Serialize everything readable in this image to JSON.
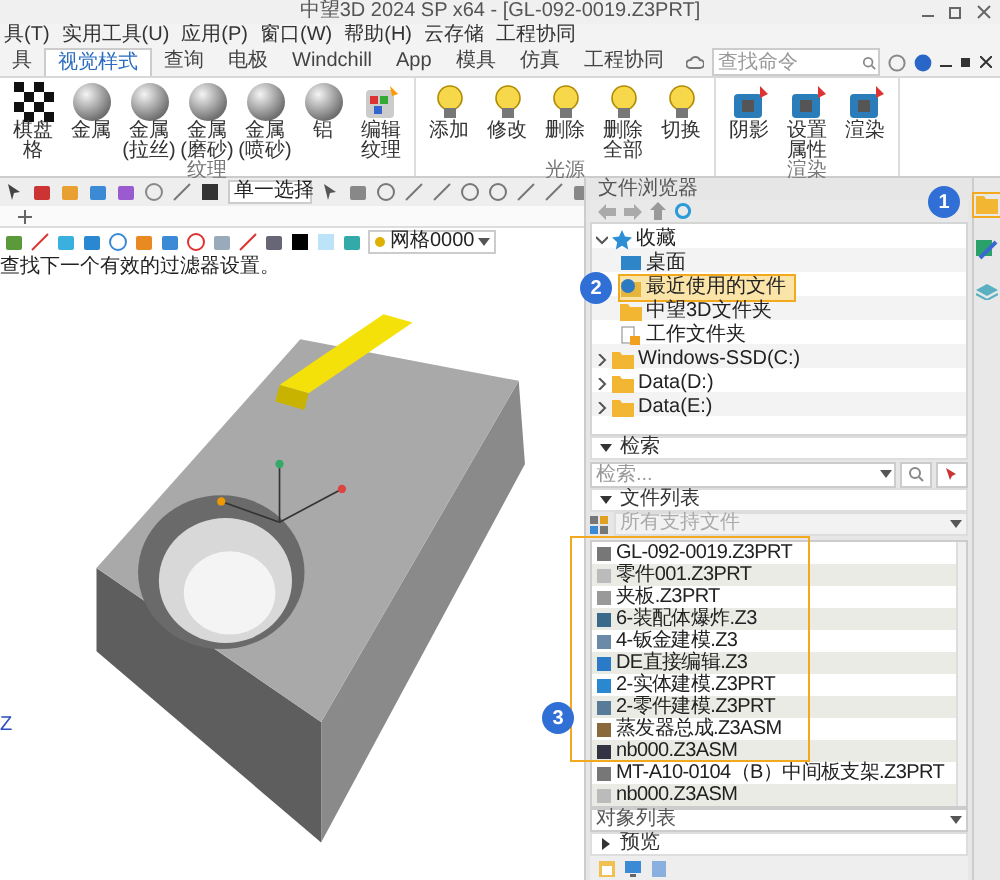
{
  "title_bar": {
    "title": "中望3D 2024 SP x64 - [GL-092-0019.Z3PRT]"
  },
  "menu": [
    "具(T)",
    "实用工具(U)",
    "应用(P)",
    "窗口(W)",
    "帮助(H)",
    "云存储",
    "工程协同"
  ],
  "tabs": [
    {
      "label": "具",
      "selected": false
    },
    {
      "label": "视觉样式",
      "selected": true
    },
    {
      "label": "查询",
      "selected": false
    },
    {
      "label": "电极",
      "selected": false
    },
    {
      "label": "Windchill",
      "selected": false
    },
    {
      "label": "App",
      "selected": false
    },
    {
      "label": "模具",
      "selected": false
    },
    {
      "label": "仿真",
      "selected": false
    },
    {
      "label": "工程协同",
      "selected": false
    }
  ],
  "command_search": {
    "placeholder": "查找命令"
  },
  "ribbon": {
    "groups": [
      {
        "label": "纹理",
        "buttons": [
          {
            "label": "棋盘格",
            "kind": "checker"
          },
          {
            "label": "金属",
            "kind": "sphere"
          },
          {
            "label": "金属 (拉丝)",
            "kind": "sphere"
          },
          {
            "label": "金属 (磨砂)",
            "kind": "sphere"
          },
          {
            "label": "金属 (喷砂)",
            "kind": "sphere"
          },
          {
            "label": "铝",
            "kind": "sphere"
          },
          {
            "label": "编辑纹理",
            "kind": "texture"
          }
        ]
      },
      {
        "label": "光源",
        "buttons": [
          {
            "label": "添加",
            "kind": "bulb"
          },
          {
            "label": "修改",
            "kind": "bulb"
          },
          {
            "label": "删除",
            "kind": "bulb"
          },
          {
            "label": "删除全部",
            "kind": "bulb"
          },
          {
            "label": "切换",
            "kind": "bulb"
          }
        ]
      },
      {
        "label": "渲染",
        "buttons": [
          {
            "label": "阴影",
            "kind": "render"
          },
          {
            "label": "设置属性",
            "kind": "render"
          },
          {
            "label": "渲染",
            "kind": "render"
          }
        ]
      }
    ]
  },
  "toolbar": {
    "selection_filter": "单一选择"
  },
  "view_toolbar": {
    "mesh_setting": "网格0000"
  },
  "hint": "查找下一个有效的过滤器设置。",
  "canvas": {
    "axis_label": "Z"
  },
  "file_browser": {
    "title": "文件浏览器",
    "tree": [
      {
        "label": "收藏",
        "kind": "star",
        "expanded": true,
        "selected": false,
        "children": [
          {
            "label": "桌面",
            "kind": "desktop",
            "selected": false
          },
          {
            "label": "最近使用的文件",
            "kind": "recent",
            "selected": true
          },
          {
            "label": "中望3D文件夹",
            "kind": "folder",
            "selected": false
          },
          {
            "label": "工作文件夹",
            "kind": "work",
            "selected": false
          }
        ]
      },
      {
        "label": "Windows-SSD(C:)",
        "kind": "folder",
        "expanded": false,
        "selected": false
      },
      {
        "label": "Data(D:)",
        "kind": "folder",
        "expanded": false,
        "selected": false
      },
      {
        "label": "Data(E:)",
        "kind": "folder",
        "expanded": false,
        "selected": false
      }
    ],
    "search_section": {
      "title": "检索",
      "placeholder": "检索..."
    },
    "file_list_section": {
      "title": "文件列表",
      "filter": "所有支持文件",
      "files": [
        "GL-092-0019.Z3PRT",
        "零件001.Z3PRT",
        "夹板.Z3PRT",
        "6-装配体爆炸.Z3",
        "4-钣金建模.Z3",
        "DE直接编辑.Z3",
        "2-实体建模.Z3PRT",
        "2-零件建模.Z3PRT",
        "蒸发器总成.Z3ASM",
        "nb000.Z3ASM",
        "MT-A10-0104（B）中间板支架.Z3PRT",
        "nb000.Z3ASM"
      ]
    },
    "object_list": "对象列表",
    "preview_section": {
      "title": "预览",
      "expanded": false
    }
  },
  "callouts": [
    "1",
    "2",
    "3"
  ]
}
